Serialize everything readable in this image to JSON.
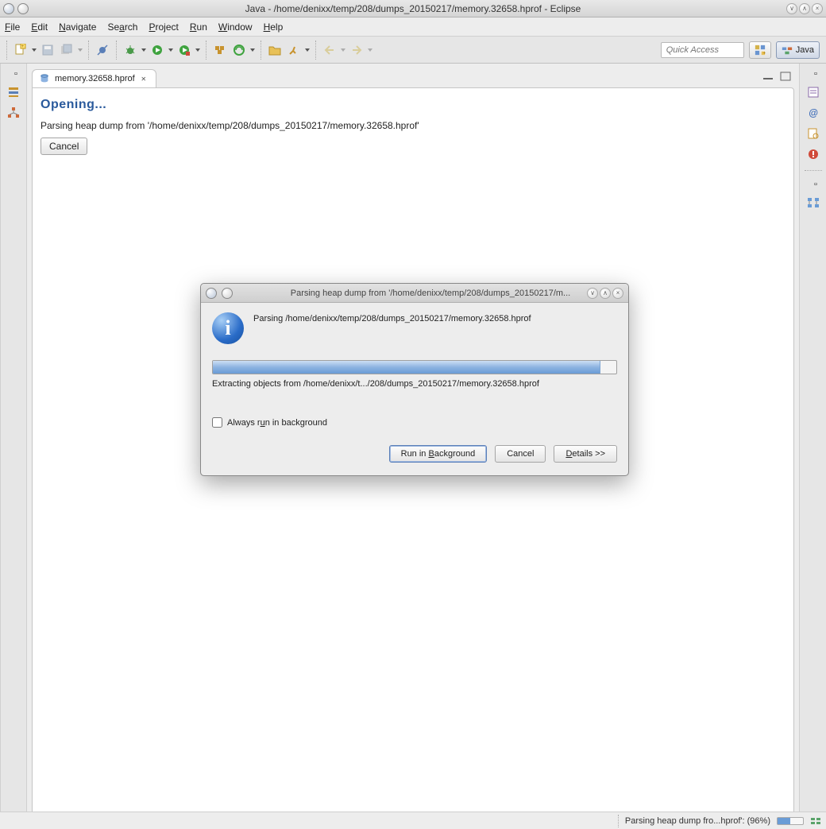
{
  "window": {
    "title": "Java - /home/denixx/temp/208/dumps_20150217/memory.32658.hprof - Eclipse"
  },
  "menubar": [
    "File",
    "Edit",
    "Navigate",
    "Search",
    "Project",
    "Run",
    "Window",
    "Help"
  ],
  "quick_access_placeholder": "Quick Access",
  "perspective": {
    "label": "Java"
  },
  "editor": {
    "tab_label": "memory.32658.hprof",
    "heading": "Opening...",
    "message": "Parsing heap dump from '/home/denixx/temp/208/dumps_20150217/memory.32658.hprof'",
    "cancel_label": "Cancel"
  },
  "dialog": {
    "title": "Parsing heap dump from '/home/denixx/temp/208/dumps_20150217/m...",
    "message": "Parsing /home/denixx/temp/208/dumps_20150217/memory.32658.hprof",
    "subtask": "Extracting objects from /home/denixx/t.../208/dumps_20150217/memory.32658.hprof",
    "progress_percent": 96,
    "checkbox_label": "Always run in background",
    "buttons": {
      "background": "Run in Background",
      "cancel": "Cancel",
      "details": "Details >>"
    }
  },
  "statusbar": {
    "text": "Parsing heap dump fro...hprof': (96%)"
  }
}
